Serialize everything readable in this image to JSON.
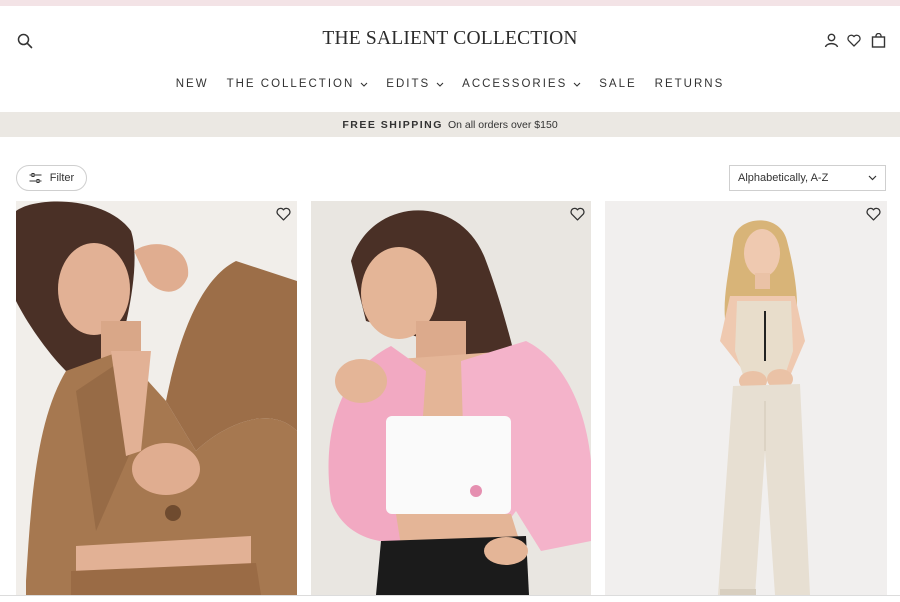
{
  "header": {
    "brand": "THE SALIENT COLLECTION",
    "icons": [
      "search-icon",
      "account-icon",
      "heart-icon",
      "bag-icon"
    ]
  },
  "nav": {
    "items": [
      {
        "label": "NEW",
        "dropdown": false
      },
      {
        "label": "THE COLLECTION",
        "dropdown": true
      },
      {
        "label": "EDITS",
        "dropdown": true
      },
      {
        "label": "ACCESSORIES",
        "dropdown": true
      },
      {
        "label": "SALE",
        "dropdown": false
      },
      {
        "label": "RETURNS",
        "dropdown": false
      }
    ]
  },
  "shipping": {
    "strong": "FREE SHIPPING",
    "text": "On all orders over $150"
  },
  "toolbar": {
    "filter_label": "Filter",
    "sort_value": "Alphabetically, A-Z"
  },
  "products": [
    {
      "image": "brown-cropped-blazer-photo",
      "bg": "#f1eeea",
      "garment": "#a67850"
    },
    {
      "image": "pink-cropped-blazer-photo",
      "bg": "#e9e6e1",
      "garment": "#f2a9c2"
    },
    {
      "image": "crochet-top-linen-trousers-photo",
      "bg": "#f1efee",
      "garment": "#e8ddcb"
    }
  ],
  "colors": {
    "ship_bar": "#ebe8e3",
    "text": "#2b2b2b"
  }
}
